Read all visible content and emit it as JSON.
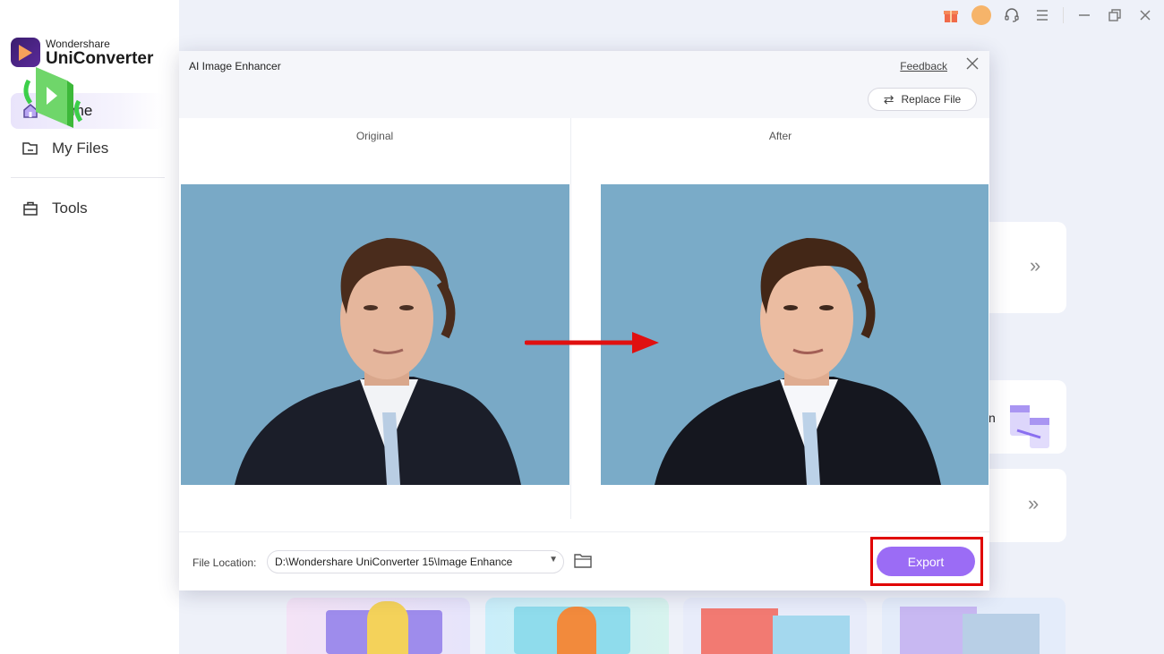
{
  "app": {
    "brand": "Wondershare",
    "product": "UniConverter"
  },
  "sidebar": {
    "items": [
      {
        "label": "Home",
        "icon": "home-icon",
        "active": true
      },
      {
        "label": "My Files",
        "icon": "folder-icon",
        "active": false
      },
      {
        "label": "Tools",
        "icon": "toolbox-icon",
        "active": false
      }
    ]
  },
  "titlebar": {
    "icons": [
      "gift-icon",
      "avatar",
      "headset-icon",
      "menu-icon",
      "minimize-icon",
      "restore-icon",
      "close-icon"
    ]
  },
  "background": {
    "partial_card_text": "n"
  },
  "dialog": {
    "title": "AI Image Enhancer",
    "feedback_label": "Feedback",
    "replace_file_label": "Replace File",
    "original_label": "Original",
    "after_label": "After",
    "file_location_label": "File Location:",
    "file_location_value": "D:\\Wondershare UniConverter 15\\Image Enhance",
    "export_label": "Export"
  },
  "colors": {
    "accent": "#9b6cf5",
    "highlight": "#e00000",
    "photo_bg": "#79a9c6"
  }
}
